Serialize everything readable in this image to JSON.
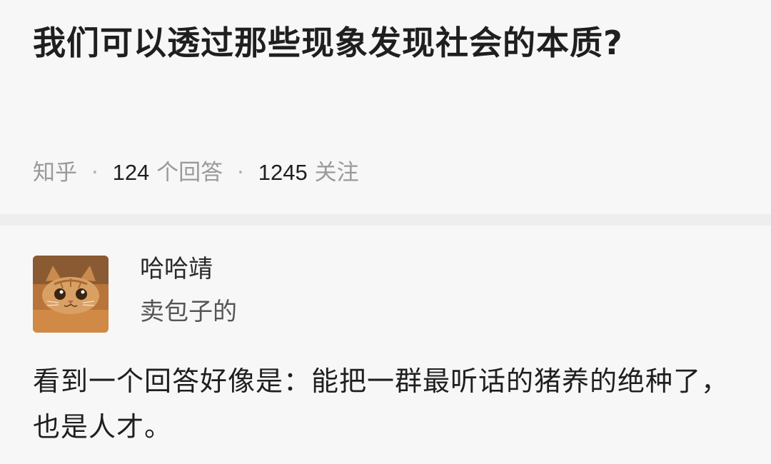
{
  "question": {
    "title": "我们可以透过那些现象发现社会的本质?",
    "meta": {
      "source": "知乎",
      "separator": "·",
      "answer_count": "124",
      "answer_label": "个回答",
      "follow_count": "1245",
      "follow_label": "关注"
    }
  },
  "answer": {
    "author": {
      "name": "哈哈靖",
      "bio": "卖包子的",
      "avatar_icon": "cat-avatar-icon"
    },
    "content": "看到一个回答好像是：能把一群最听话的猪养的绝种了，也是人才。"
  },
  "colors": {
    "background": "#f7f7f7",
    "title_text": "#1f1f1f",
    "meta_text": "#9a9a9a",
    "divider": "#eeeeee"
  }
}
